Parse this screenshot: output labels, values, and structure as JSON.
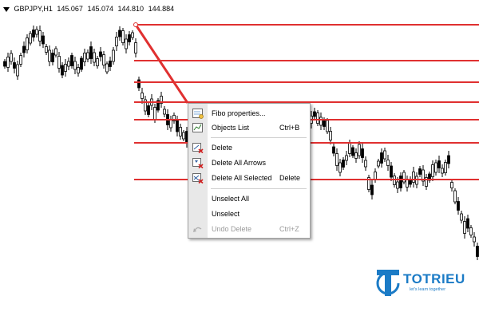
{
  "chart": {
    "symbol": "GBPJPY,H1",
    "open": "145.067",
    "high": "145.074",
    "low": "144.810",
    "close": "144.884",
    "colors": {
      "line": "#e03030",
      "candle": "#000000",
      "background": "#ffffff"
    }
  },
  "context_menu": {
    "items": [
      {
        "label": "Fibo properties...",
        "shortcut": "",
        "icon": "fibo-properties-icon",
        "enabled": true
      },
      {
        "label": "Objects List",
        "shortcut": "Ctrl+B",
        "icon": "objects-list-icon",
        "enabled": true
      },
      {
        "label": "Delete",
        "shortcut": "",
        "icon": "delete-icon",
        "enabled": true
      },
      {
        "label": "Delete All Arrows",
        "shortcut": "",
        "icon": "delete-arrows-icon",
        "enabled": true
      },
      {
        "label": "Delete All Selected",
        "shortcut": "Delete",
        "icon": "delete-selected-icon",
        "enabled": true
      },
      {
        "label": "Unselect All",
        "shortcut": "",
        "icon": "",
        "enabled": true
      },
      {
        "label": "Unselect",
        "shortcut": "",
        "icon": "",
        "enabled": true
      },
      {
        "label": "Undo Delete",
        "shortcut": "Ctrl+Z",
        "icon": "undo-icon",
        "enabled": false
      }
    ]
  },
  "watermark": {
    "brand": "TOTRIEU",
    "tagline": "let's learn together",
    "color": "#1b7bc6"
  }
}
